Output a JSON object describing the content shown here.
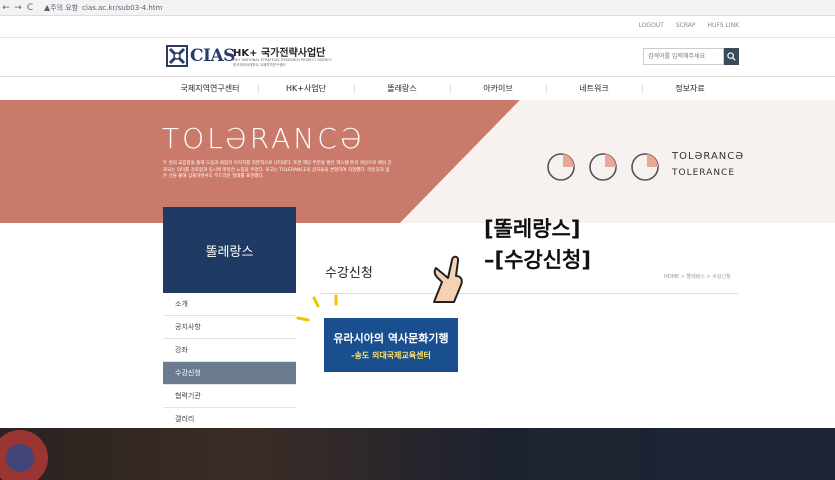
{
  "browser": {
    "back": "←",
    "forward": "→",
    "reload": "C",
    "warning": "▲",
    "security_label": "주의 요함",
    "url": "cias.ac.kr/sub03-4.htm"
  },
  "util_links": [
    "LOGOUT",
    "SCRAP",
    "HUFS LINK"
  ],
  "logo": {
    "cias": "CIAS",
    "title": "HK+ 국가전략사업단",
    "sub1": "HK+ NATIONAL STRATEGIC RESEARCH PROJECT AGENCY",
    "sub2": "한국외국어대학교 국제지역연구센터"
  },
  "search": {
    "placeholder": "검색어를 입력해주세요"
  },
  "nav": [
    "국제지역연구센터",
    "HK+사업단",
    "똘레랑스",
    "아카이브",
    "네트워크",
    "정보자료"
  ],
  "banner": {
    "title": "TOLƏRANCƏ",
    "desc": "두 원의 교집합을 통해 도움과 화합의 이미지를 직관적으로 나타냈다. 또한 해당 부분을 밝은 파스텔 톤의 색상으로 채워 강조되는 의미를 강조함과 동시에 따뜻한 느낌을 주었다. 로고는 TOLERANCE의 글자들을 변형하여 작업했다. 라운딩과 얇은 선을 통해 심플하면서도 부드러운 형태를 표현했다.",
    "logo_text1": "TOLƏRANCƏ",
    "logo_text2": "TOLERANCE"
  },
  "colors": {
    "banner_accent": "#c97a6a",
    "side_box": "#1f3b63",
    "active_item": "#6b7c8f",
    "course_banner": "#1a4f8f"
  },
  "side": {
    "title": "똘레랑스",
    "items": [
      "소개",
      "공지사항",
      "강좌",
      "수강신청",
      "협력기관",
      "갤러리"
    ],
    "active_index": 3
  },
  "content": {
    "title": "수강신청",
    "breadcrumb": "HOME > 똘레랑스 > 수강신청",
    "course_line1": "유라시아의 역사문화기행",
    "course_line2": "-송도 외대국제교육센터"
  },
  "callout": {
    "line1": "[똘레랑스]",
    "line2": "–[수강신청]"
  }
}
